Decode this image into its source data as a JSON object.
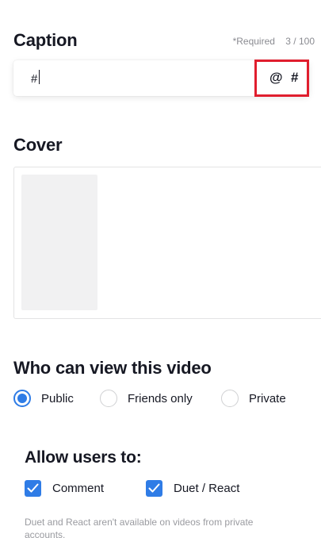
{
  "caption": {
    "title": "Caption",
    "required_label": "*Required",
    "counter": "3 / 100",
    "value": "#",
    "mention_symbol": "@",
    "hashtag_symbol": "#"
  },
  "cover": {
    "title": "Cover"
  },
  "privacy": {
    "title": "Who can view this video",
    "options": [
      {
        "label": "Public",
        "selected": true
      },
      {
        "label": "Friends only",
        "selected": false
      },
      {
        "label": "Private",
        "selected": false
      }
    ]
  },
  "allow": {
    "title": "Allow users to:",
    "options": [
      {
        "label": "Comment",
        "checked": true
      },
      {
        "label": "Duet / React",
        "checked": true
      }
    ],
    "note": "Duet and React aren't available on videos from private accounts."
  },
  "colors": {
    "accent": "#2f7ce6",
    "highlight": "#e01e2e",
    "text": "#161823",
    "muted": "#8a8b91"
  }
}
